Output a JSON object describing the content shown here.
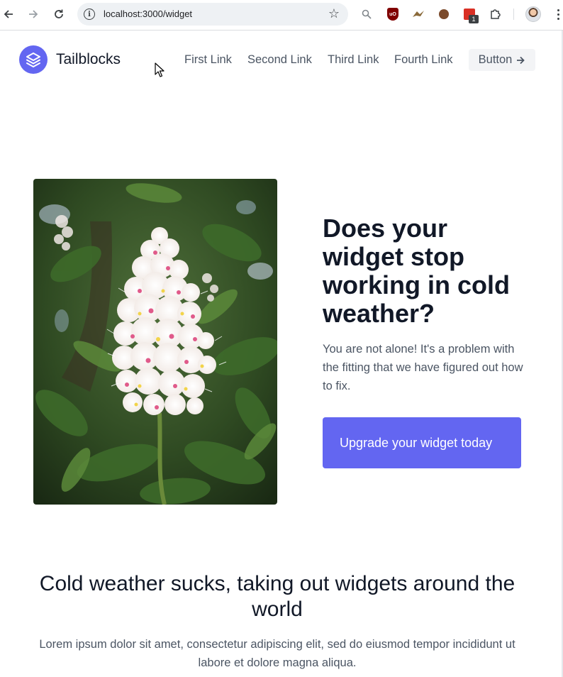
{
  "browser": {
    "url": "localhost:3000/widget",
    "back_icon": "arrow-left-icon",
    "forward_icon": "arrow-right-icon",
    "reload_icon": "reload-icon",
    "site_info_icon": "info-icon",
    "bookmark_icon": "star-icon",
    "extension_badge_count": "1"
  },
  "header": {
    "brand": "Tailblocks",
    "brand_color": "#6366f1",
    "links": [
      "First Link",
      "Second Link",
      "Third Link",
      "Fourth Link"
    ],
    "button_label": "Button",
    "button_icon": "arrow-right-icon"
  },
  "hero": {
    "image_subject": "flower-photo",
    "title": "Does your widget stop working in cold weather?",
    "description": "You are not alone! It's a problem with the fitting that we have figured out how to fix.",
    "cta_label": "Upgrade your widget today",
    "cta_color": "#6366f1"
  },
  "section": {
    "title": "Cold weather sucks, taking out widgets around the world",
    "description": "Lorem ipsum dolor sit amet, consectetur adipiscing elit, sed do eiusmod tempor incididunt ut labore et dolore magna aliqua."
  }
}
